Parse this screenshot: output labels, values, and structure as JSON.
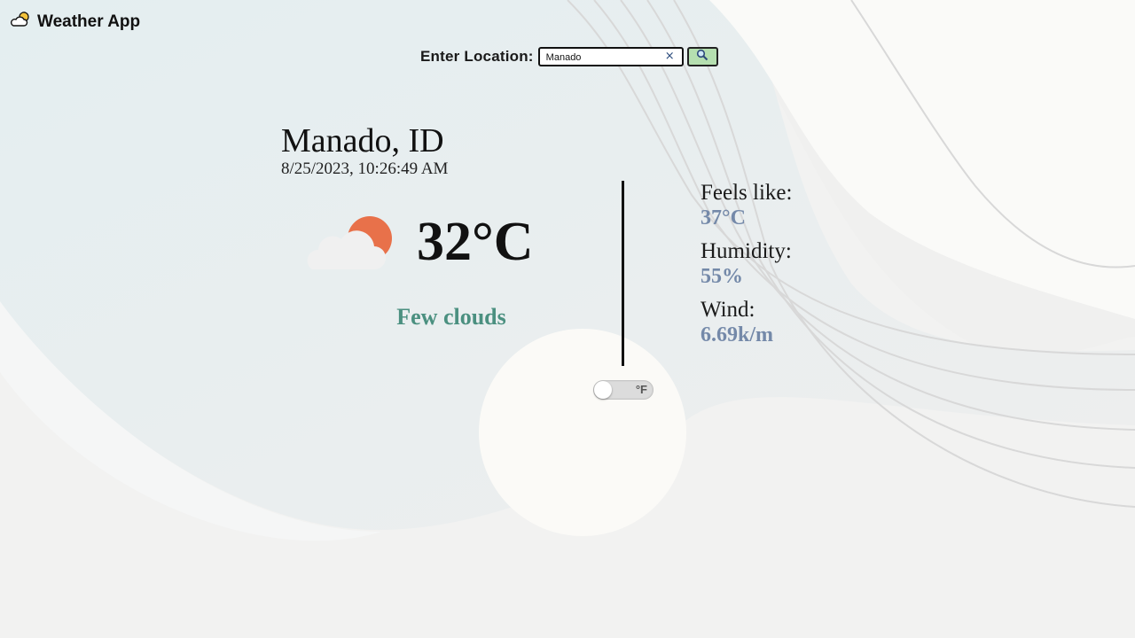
{
  "app": {
    "title": "Weather App",
    "logo_icon": "partly-cloudy-icon"
  },
  "search": {
    "label": "Enter Location:",
    "value": "Manado",
    "clear_icon": "close-icon",
    "clear_glyph": "×",
    "button_icon": "search-icon"
  },
  "location": {
    "city": "Manado, ID",
    "datetime": "8/25/2023, 10:26:49 AM"
  },
  "current": {
    "icon": "partly-cloudy-icon",
    "temperature": "32°C",
    "description": "Few clouds"
  },
  "unit_toggle": {
    "label": "°F",
    "enabled": false
  },
  "details": [
    {
      "label": "Feels like:",
      "value": "37°C"
    },
    {
      "label": "Humidity:",
      "value": "55%"
    },
    {
      "label": "Wind:",
      "value": "6.69k/m"
    }
  ],
  "colors": {
    "background": "#f1f1f0",
    "description": "#4b9080",
    "detail_value": "#7489a9",
    "search_button": "#b5dfb0",
    "sun": "#e8714a"
  }
}
